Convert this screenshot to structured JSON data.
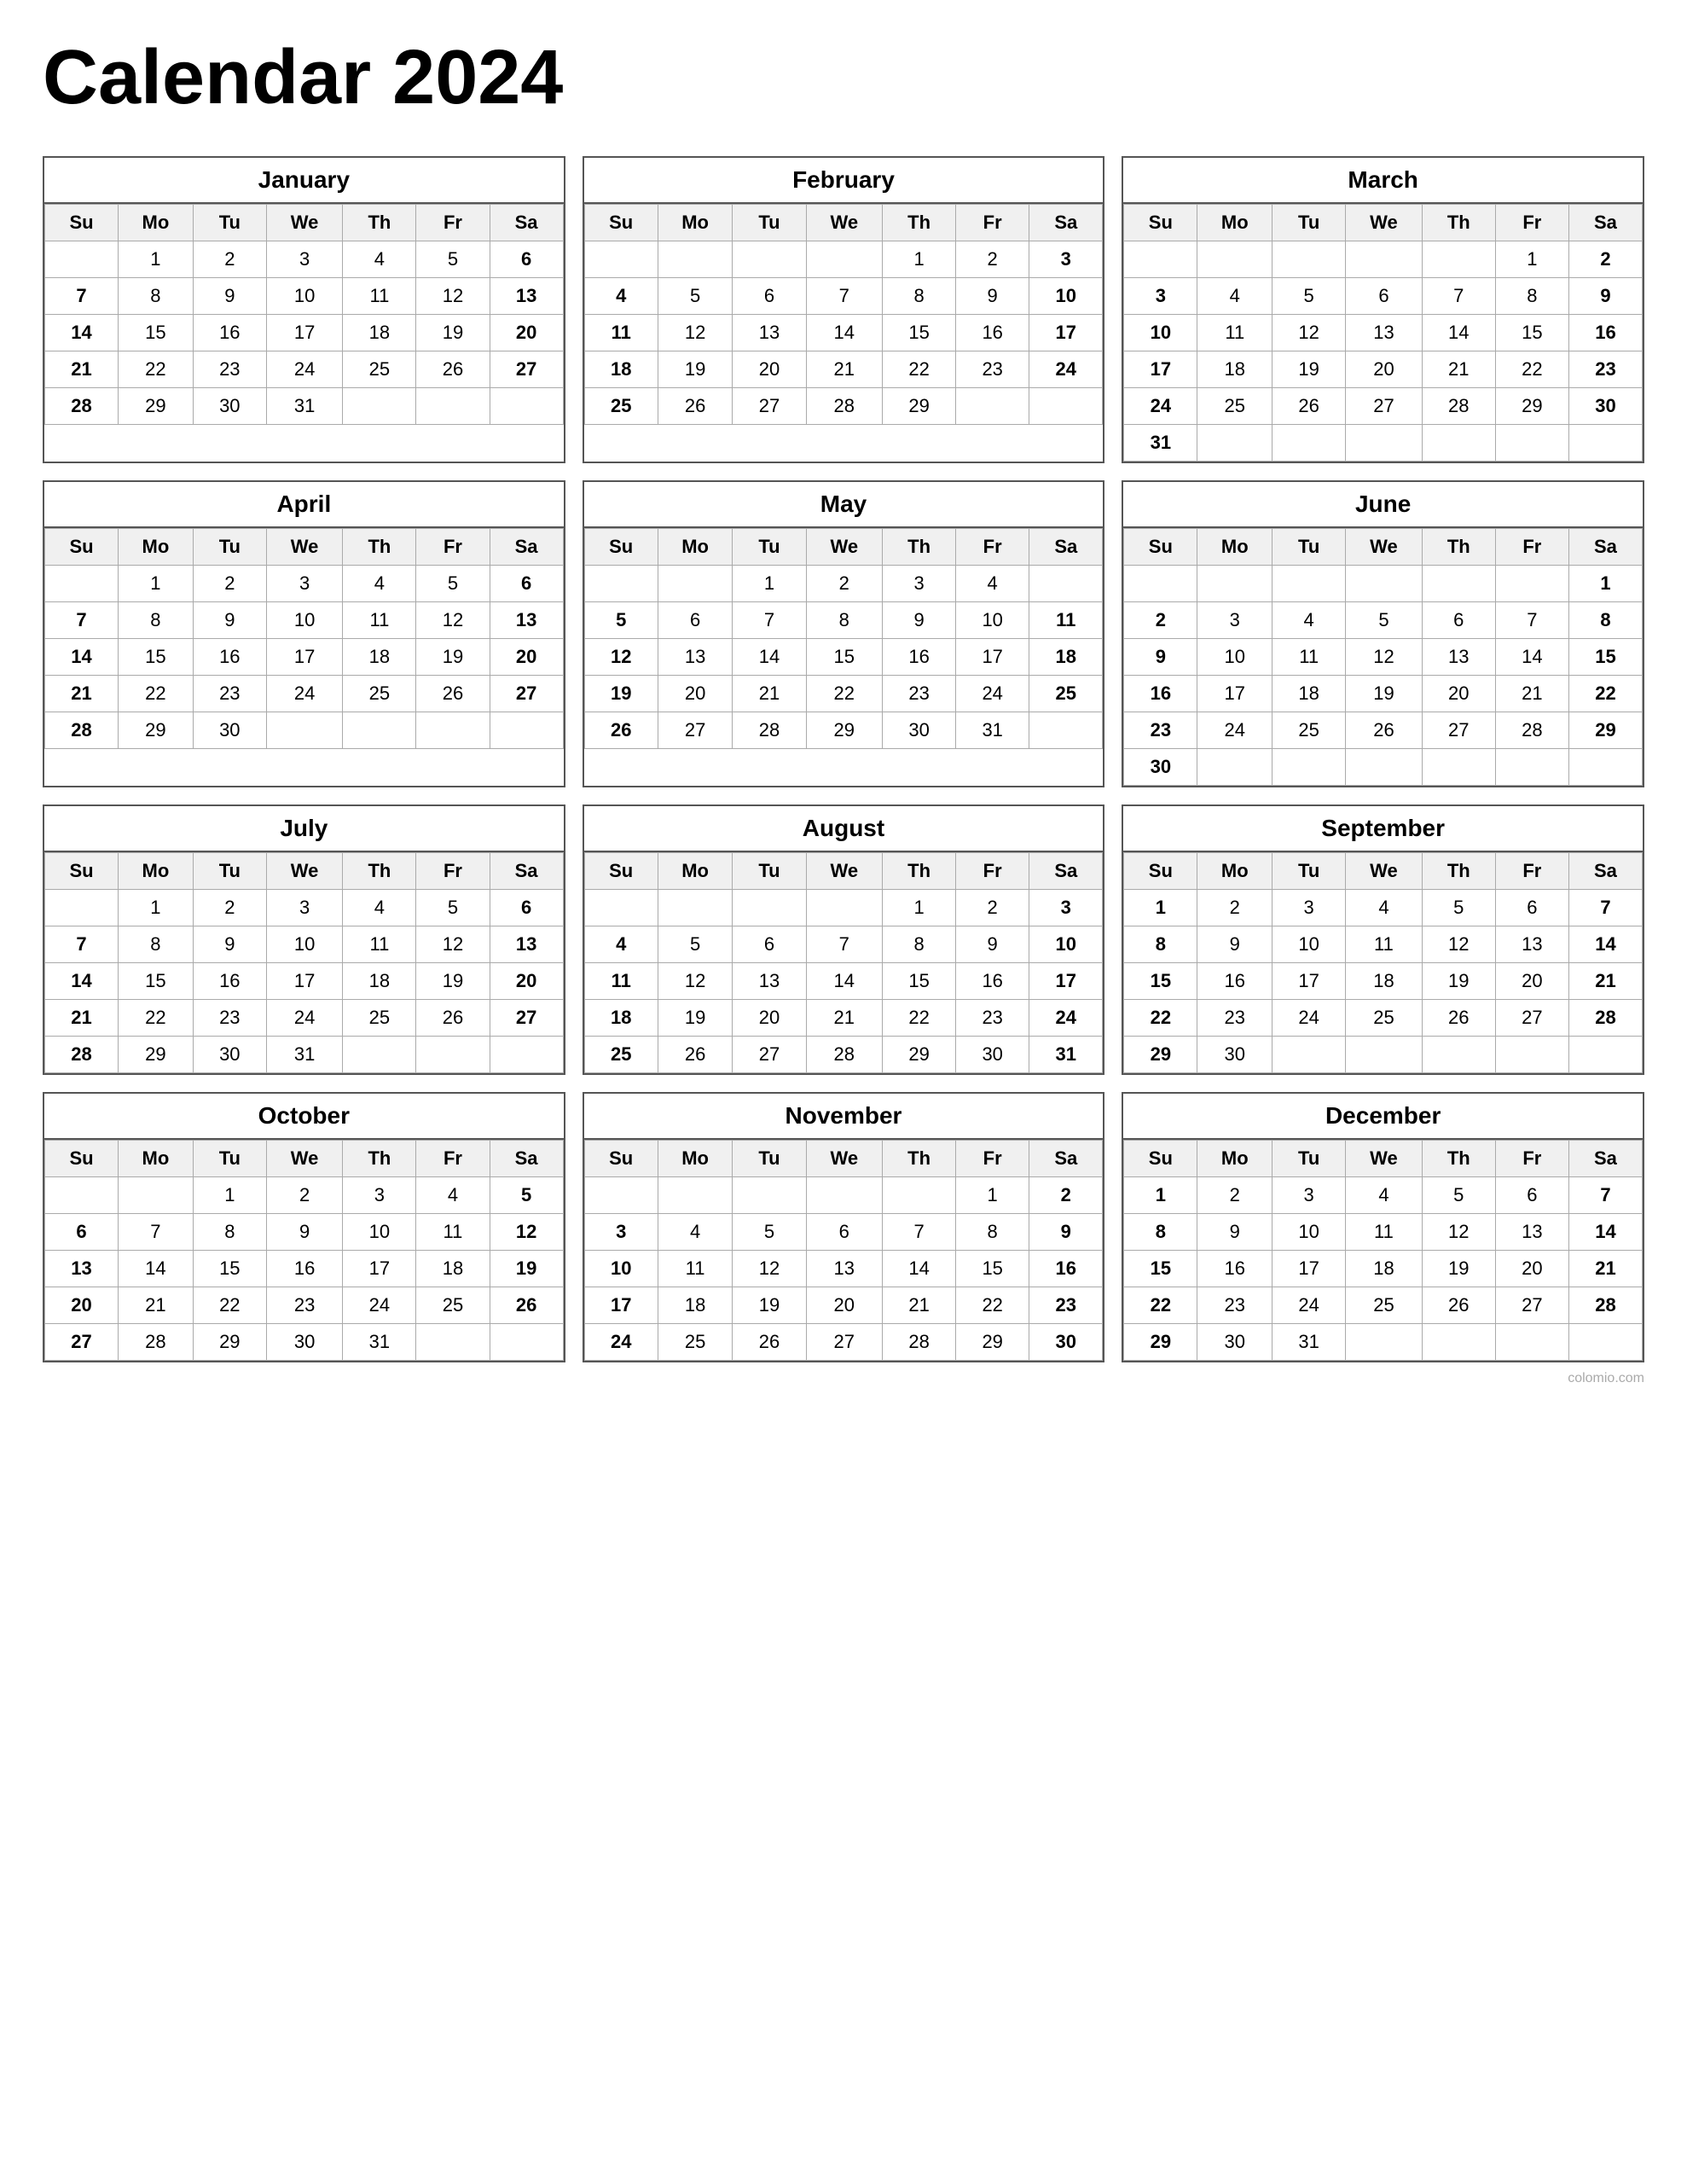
{
  "title": "Calendar 2024",
  "watermark": "colomio.com",
  "months": [
    {
      "name": "January",
      "startDay": 1,
      "days": 31,
      "weeks": [
        [
          "",
          "1",
          "2",
          "3",
          "4",
          "5",
          "6"
        ],
        [
          "7",
          "8",
          "9",
          "10",
          "11",
          "12",
          "13"
        ],
        [
          "14",
          "15",
          "16",
          "17",
          "18",
          "19",
          "20"
        ],
        [
          "21",
          "22",
          "23",
          "24",
          "25",
          "26",
          "27"
        ],
        [
          "28",
          "29",
          "30",
          "31",
          "",
          "",
          ""
        ]
      ]
    },
    {
      "name": "February",
      "startDay": 4,
      "days": 29,
      "weeks": [
        [
          "",
          "",
          "",
          "",
          "1",
          "2",
          "3"
        ],
        [
          "4",
          "5",
          "6",
          "7",
          "8",
          "9",
          "10"
        ],
        [
          "11",
          "12",
          "13",
          "14",
          "15",
          "16",
          "17"
        ],
        [
          "18",
          "19",
          "20",
          "21",
          "22",
          "23",
          "24"
        ],
        [
          "25",
          "26",
          "27",
          "28",
          "29",
          "",
          ""
        ]
      ]
    },
    {
      "name": "March",
      "startDay": 5,
      "days": 31,
      "weeks": [
        [
          "",
          "",
          "",
          "",
          "",
          "1",
          "2"
        ],
        [
          "3",
          "4",
          "5",
          "6",
          "7",
          "8",
          "9"
        ],
        [
          "10",
          "11",
          "12",
          "13",
          "14",
          "15",
          "16"
        ],
        [
          "17",
          "18",
          "19",
          "20",
          "21",
          "22",
          "23"
        ],
        [
          "24",
          "25",
          "26",
          "27",
          "28",
          "29",
          "30"
        ],
        [
          "31",
          "",
          "",
          "",
          "",
          "",
          ""
        ]
      ]
    },
    {
      "name": "April",
      "startDay": 1,
      "days": 30,
      "weeks": [
        [
          "",
          "1",
          "2",
          "3",
          "4",
          "5",
          "6"
        ],
        [
          "7",
          "8",
          "9",
          "10",
          "11",
          "12",
          "13"
        ],
        [
          "14",
          "15",
          "16",
          "17",
          "18",
          "19",
          "20"
        ],
        [
          "21",
          "22",
          "23",
          "24",
          "25",
          "26",
          "27"
        ],
        [
          "28",
          "29",
          "30",
          "",
          "",
          "",
          ""
        ]
      ]
    },
    {
      "name": "May",
      "startDay": 3,
      "days": 31,
      "weeks": [
        [
          "",
          "",
          "1",
          "2",
          "3",
          "4",
          ""
        ],
        [
          "5",
          "6",
          "7",
          "8",
          "9",
          "10",
          "11"
        ],
        [
          "12",
          "13",
          "14",
          "15",
          "16",
          "17",
          "18"
        ],
        [
          "19",
          "20",
          "21",
          "22",
          "23",
          "24",
          "25"
        ],
        [
          "26",
          "27",
          "28",
          "29",
          "30",
          "31",
          ""
        ]
      ]
    },
    {
      "name": "June",
      "startDay": 6,
      "days": 30,
      "weeks": [
        [
          "",
          "",
          "",
          "",
          "",
          "",
          "1"
        ],
        [
          "2",
          "3",
          "4",
          "5",
          "6",
          "7",
          "8"
        ],
        [
          "9",
          "10",
          "11",
          "12",
          "13",
          "14",
          "15"
        ],
        [
          "16",
          "17",
          "18",
          "19",
          "20",
          "21",
          "22"
        ],
        [
          "23",
          "24",
          "25",
          "26",
          "27",
          "28",
          "29"
        ],
        [
          "30",
          "",
          "",
          "",
          "",
          "",
          ""
        ]
      ]
    },
    {
      "name": "July",
      "startDay": 1,
      "days": 31,
      "weeks": [
        [
          "",
          "1",
          "2",
          "3",
          "4",
          "5",
          "6"
        ],
        [
          "7",
          "8",
          "9",
          "10",
          "11",
          "12",
          "13"
        ],
        [
          "14",
          "15",
          "16",
          "17",
          "18",
          "19",
          "20"
        ],
        [
          "21",
          "22",
          "23",
          "24",
          "25",
          "26",
          "27"
        ],
        [
          "28",
          "29",
          "30",
          "31",
          "",
          "",
          ""
        ]
      ]
    },
    {
      "name": "August",
      "startDay": 4,
      "days": 31,
      "weeks": [
        [
          "",
          "",
          "",
          "",
          "1",
          "2",
          "3"
        ],
        [
          "4",
          "5",
          "6",
          "7",
          "8",
          "9",
          "10"
        ],
        [
          "11",
          "12",
          "13",
          "14",
          "15",
          "16",
          "17"
        ],
        [
          "18",
          "19",
          "20",
          "21",
          "22",
          "23",
          "24"
        ],
        [
          "25",
          "26",
          "27",
          "28",
          "29",
          "30",
          "31"
        ]
      ]
    },
    {
      "name": "September",
      "startDay": 0,
      "days": 30,
      "weeks": [
        [
          "1",
          "2",
          "3",
          "4",
          "5",
          "6",
          "7"
        ],
        [
          "8",
          "9",
          "10",
          "11",
          "12",
          "13",
          "14"
        ],
        [
          "15",
          "16",
          "17",
          "18",
          "19",
          "20",
          "21"
        ],
        [
          "22",
          "23",
          "24",
          "25",
          "26",
          "27",
          "28"
        ],
        [
          "29",
          "30",
          "",
          "",
          "",
          "",
          ""
        ]
      ]
    },
    {
      "name": "October",
      "startDay": 2,
      "days": 31,
      "weeks": [
        [
          "",
          "",
          "1",
          "2",
          "3",
          "4",
          "5"
        ],
        [
          "6",
          "7",
          "8",
          "9",
          "10",
          "11",
          "12"
        ],
        [
          "13",
          "14",
          "15",
          "16",
          "17",
          "18",
          "19"
        ],
        [
          "20",
          "21",
          "22",
          "23",
          "24",
          "25",
          "26"
        ],
        [
          "27",
          "28",
          "29",
          "30",
          "31",
          "",
          ""
        ]
      ]
    },
    {
      "name": "November",
      "startDay": 5,
      "days": 30,
      "weeks": [
        [
          "",
          "",
          "",
          "",
          "",
          "1",
          "2"
        ],
        [
          "3",
          "4",
          "5",
          "6",
          "7",
          "8",
          "9"
        ],
        [
          "10",
          "11",
          "12",
          "13",
          "14",
          "15",
          "16"
        ],
        [
          "17",
          "18",
          "19",
          "20",
          "21",
          "22",
          "23"
        ],
        [
          "24",
          "25",
          "26",
          "27",
          "28",
          "29",
          "30"
        ]
      ]
    },
    {
      "name": "December",
      "startDay": 0,
      "days": 31,
      "weeks": [
        [
          "1",
          "2",
          "3",
          "4",
          "5",
          "6",
          "7"
        ],
        [
          "8",
          "9",
          "10",
          "11",
          "12",
          "13",
          "14"
        ],
        [
          "15",
          "16",
          "17",
          "18",
          "19",
          "20",
          "21"
        ],
        [
          "22",
          "23",
          "24",
          "25",
          "26",
          "27",
          "28"
        ],
        [
          "29",
          "30",
          "31",
          "",
          "",
          "",
          ""
        ]
      ]
    }
  ],
  "dayHeaders": [
    "Su",
    "Mo",
    "Tu",
    "We",
    "Th",
    "Fr",
    "Sa"
  ]
}
